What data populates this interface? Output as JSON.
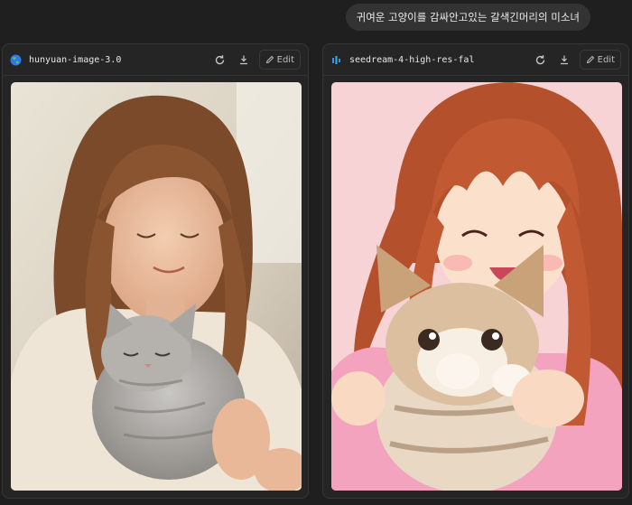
{
  "prompt": {
    "text": "귀여운 고양이를 감싸안고있는 갈색긴머리의 미소녀"
  },
  "cards": [
    {
      "model": "hunyuan-image-3.0",
      "icon": "globe-icon",
      "edit_label": "Edit"
    },
    {
      "model": "seedream-4-high-res-fal",
      "icon": "seedream-logo-icon",
      "edit_label": "Edit"
    }
  ],
  "colors": {
    "background": "#1f1f1f",
    "card": "#252525",
    "prompt_bubble": "#333333"
  }
}
